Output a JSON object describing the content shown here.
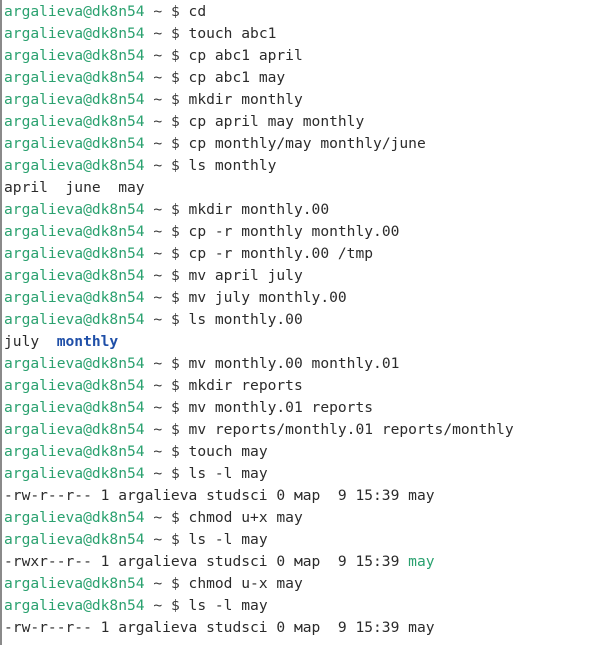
{
  "prompt": {
    "user_host": "argalieva@dk8n54",
    "tail": " ~ $ "
  },
  "lines": [
    {
      "kind": "cmd",
      "text": "cd"
    },
    {
      "kind": "cmd",
      "text": "touch abc1"
    },
    {
      "kind": "cmd",
      "text": "cp abc1 april"
    },
    {
      "kind": "cmd",
      "text": "cp abc1 may"
    },
    {
      "kind": "cmd",
      "text": "mkdir monthly"
    },
    {
      "kind": "cmd",
      "text": "cp april may monthly"
    },
    {
      "kind": "cmd",
      "text": "cp monthly/may monthly/june"
    },
    {
      "kind": "cmd",
      "text": "ls monthly"
    },
    {
      "kind": "out",
      "text": "april  june  may"
    },
    {
      "kind": "cmd",
      "text": "mkdir monthly.00"
    },
    {
      "kind": "cmd",
      "text": "cp -r monthly monthly.00"
    },
    {
      "kind": "cmd",
      "text": "cp -r monthly.00 /tmp"
    },
    {
      "kind": "cmd",
      "text": "mv april july"
    },
    {
      "kind": "cmd",
      "text": "mv july monthly.00"
    },
    {
      "kind": "cmd",
      "text": "ls monthly.00"
    },
    {
      "kind": "out-dir",
      "text": "july  ",
      "highlight": "monthly"
    },
    {
      "kind": "cmd",
      "text": "mv monthly.00 monthly.01"
    },
    {
      "kind": "cmd",
      "text": "mkdir reports"
    },
    {
      "kind": "cmd",
      "text": "mv monthly.01 reports"
    },
    {
      "kind": "cmd",
      "text": "mv reports/monthly.01 reports/monthly"
    },
    {
      "kind": "cmd",
      "text": "touch may"
    },
    {
      "kind": "cmd",
      "text": "ls -l may"
    },
    {
      "kind": "out",
      "text": "-rw-r--r-- 1 argalieva studsci 0 мар  9 15:39 may"
    },
    {
      "kind": "cmd",
      "text": "chmod u+x may"
    },
    {
      "kind": "cmd",
      "text": "ls -l may"
    },
    {
      "kind": "out-exec",
      "text": "-rwxr--r-- 1 argalieva studsci 0 мар  9 15:39 ",
      "highlight": "may"
    },
    {
      "kind": "cmd",
      "text": "chmod u-x may"
    },
    {
      "kind": "cmd",
      "text": "ls -l may"
    },
    {
      "kind": "out",
      "text": "-rw-r--r-- 1 argalieva studsci 0 мар  9 15:39 may"
    }
  ],
  "colors": {
    "prompt_green": "#2aa16f",
    "directory_blue": "#1f4fa8",
    "executable_green": "#2aa16f",
    "text": "#2b2b2b",
    "background": "#ffffff"
  }
}
